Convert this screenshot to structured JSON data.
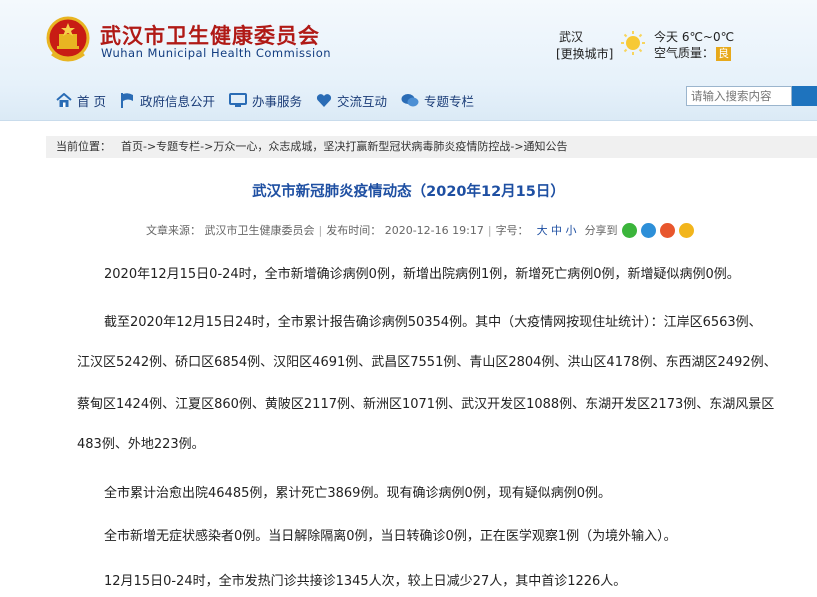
{
  "header": {
    "site_title_cn": "武汉市卫生健康委员会",
    "site_title_en": "Wuhan Municipal Health Commission",
    "weather": {
      "city": "武汉",
      "change_city": "[更换城市]",
      "today": "今天 6℃~0℃",
      "air_quality_label": "空气质量：",
      "air_quality_value": "良"
    },
    "nav": [
      {
        "label": "首 页",
        "icon": "home-icon"
      },
      {
        "label": "政府信息公开",
        "icon": "flag-icon"
      },
      {
        "label": "办事服务",
        "icon": "monitor-icon"
      },
      {
        "label": "交流互动",
        "icon": "heart-icon"
      },
      {
        "label": "专题专栏",
        "icon": "chat-icon"
      }
    ],
    "search_placeholder": "请输入搜索内容"
  },
  "breadcrumb": {
    "label": "当前位置：",
    "path": "首页->专题专栏->万众一心，众志成城，坚决打赢新型冠状病毒肺炎疫情防控战->通知公告"
  },
  "article": {
    "title": "武汉市新冠肺炎疫情动态（2020年12月15日）",
    "meta": {
      "source": "文章来源： 武汉市卫生健康委员会",
      "published": "发布时间： 2020-12-16 19:17",
      "font_label": "字号：",
      "font_sizes": "大 中 小",
      "share_label": "分享到"
    },
    "paragraphs": [
      "2020年12月15日0-24时，全市新增确诊病例0例，新增出院病例1例，新增死亡病例0例，新增疑似病例0例。",
      "截至2020年12月15日24时，全市累计报告确诊病例50354例。其中（大疫情网按现住址统计）：江岸区6563例、",
      "江汉区5242例、硚口区6854例、汉阳区4691例、武昌区7551例、青山区2804例、洪山区4178例、东西湖区2492例、",
      "蔡甸区1424例、江夏区860例、黄陂区2117例、新洲区1071例、武汉开发区1088例、东湖开发区2173例、东湖风景区",
      "483例、外地223例。",
      "全市累计治愈出院46485例，累计死亡3869例。现有确诊病例0例，现有疑似病例0例。",
      "全市新增无症状感染者0例。当日解除隔离0例，当日转确诊0例，正在医学观察1例（为境外输入）。",
      "12月15日0-24时，全市发热门诊共接诊1345人次，较上日减少27人，其中首诊1226人。"
    ]
  },
  "colors": {
    "title_red": "#b01a16",
    "nav_blue": "#1b3d78",
    "article_title_blue": "#1e4fa2",
    "air_quality_badge": "#e7a91b"
  }
}
